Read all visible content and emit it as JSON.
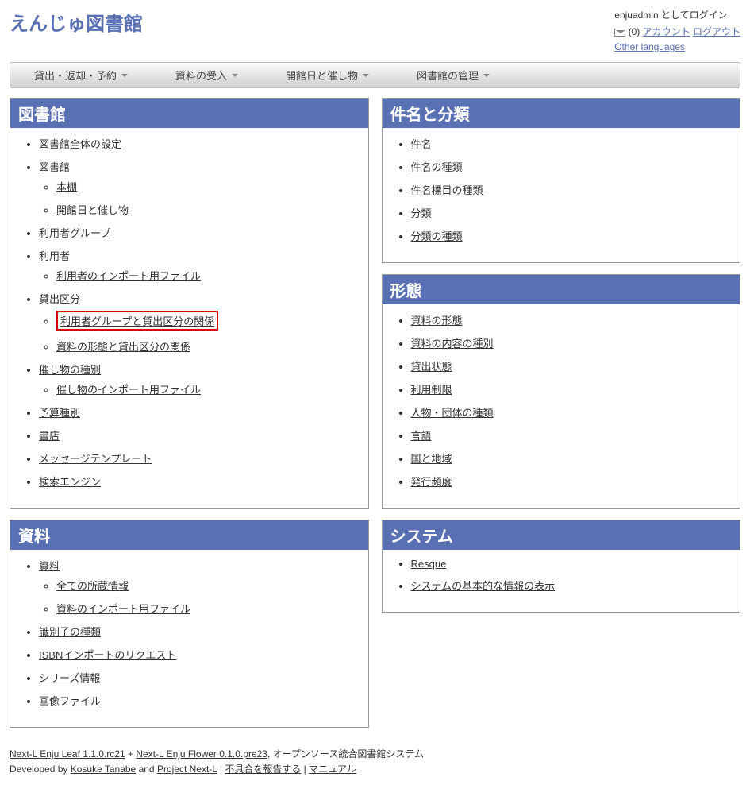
{
  "header": {
    "title": "えんじゅ図書館",
    "login_as": "enjuadmin としてログイン",
    "msg_count": "(0)",
    "account": "アカウント",
    "logout": "ログアウト",
    "other_lang": "Other languages"
  },
  "menubar": {
    "items": [
      "貸出・返却・予約",
      "資料の受入",
      "開館日と催し物",
      "図書館の管理"
    ]
  },
  "panels": {
    "library": {
      "title": "図書館",
      "items": [
        {
          "label": "図書館全体の設定"
        },
        {
          "label": "図書館",
          "children": [
            {
              "label": "本棚"
            },
            {
              "label": "開館日と催し物"
            }
          ]
        },
        {
          "label": "利用者グループ"
        },
        {
          "label": "利用者",
          "children": [
            {
              "label": "利用者のインポート用ファイル"
            }
          ]
        },
        {
          "label": "貸出区分",
          "children": [
            {
              "label": "利用者グループと貸出区分の関係",
              "highlight": true
            },
            {
              "label": "資料の形態と貸出区分の関係"
            }
          ]
        },
        {
          "label": "催し物の種別",
          "children": [
            {
              "label": "催し物のインポート用ファイル"
            }
          ]
        },
        {
          "label": "予算種別"
        },
        {
          "label": "書店"
        },
        {
          "label": "メッセージテンプレート"
        },
        {
          "label": "検索エンジン"
        }
      ]
    },
    "material": {
      "title": "資料",
      "items": [
        {
          "label": "資料",
          "children": [
            {
              "label": "全ての所蔵情報"
            },
            {
              "label": "資料のインポート用ファイル"
            }
          ]
        },
        {
          "label": "識別子の種類"
        },
        {
          "label": "ISBNインポートのリクエスト"
        },
        {
          "label": "シリーズ情報"
        },
        {
          "label": "画像ファイル"
        }
      ]
    },
    "subject": {
      "title": "件名と分類",
      "items": [
        {
          "label": "件名"
        },
        {
          "label": "件名の種類"
        },
        {
          "label": "件名標目の種類"
        },
        {
          "label": "分類"
        },
        {
          "label": "分類の種類"
        }
      ]
    },
    "form": {
      "title": "形態",
      "items": [
        {
          "label": "資料の形態"
        },
        {
          "label": "資料の内容の種別"
        },
        {
          "label": "貸出状態"
        },
        {
          "label": "利用制限"
        },
        {
          "label": "人物・団体の種類"
        },
        {
          "label": "言語"
        },
        {
          "label": "国と地域"
        },
        {
          "label": "発行頻度"
        }
      ]
    },
    "system": {
      "title": "システム",
      "items": [
        {
          "label": "Resque"
        },
        {
          "label": "システムの基本的な情報の表示"
        }
      ]
    }
  },
  "footer": {
    "leaf": "Next-L Enju Leaf 1.1.0.rc21",
    "plus": " + ",
    "flower": "Next-L Enju Flower 0.1.0.pre23",
    "tagline": ", オープンソース統合図書館システム",
    "developed": "Developed by ",
    "dev1": "Kosuke Tanabe",
    "and": " and ",
    "dev2": "Project Next-L",
    "sep": " | ",
    "report": "不具合を報告する",
    "manual": "マニュアル"
  }
}
